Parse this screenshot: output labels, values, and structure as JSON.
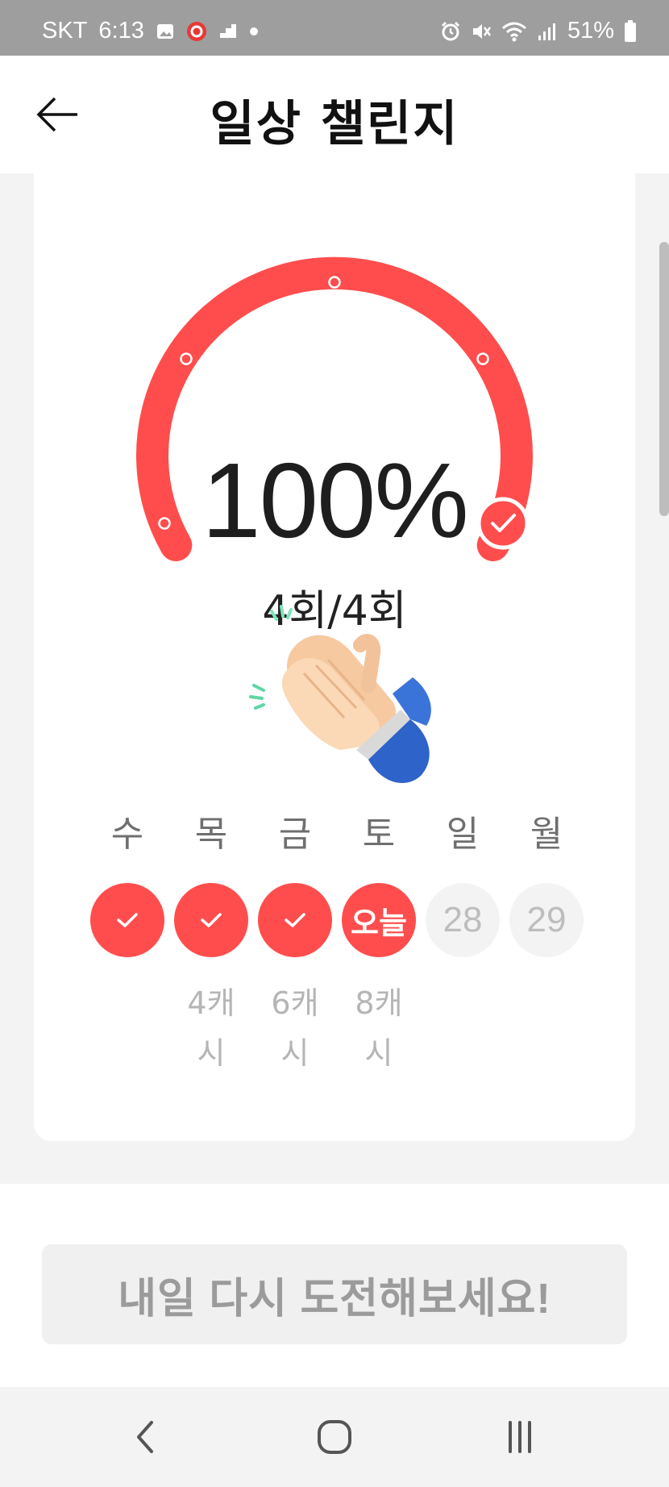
{
  "status_bar": {
    "carrier": "SKT",
    "time": "6:13",
    "battery": "51%"
  },
  "header": {
    "title": "일상 챌린지"
  },
  "challenge": {
    "progress_percent": 100,
    "percent_text": "100%",
    "count_text": "4회/4회",
    "accent_color": "#ff4d4d"
  },
  "days": [
    {
      "label": "수",
      "state": "done",
      "note": "",
      "circle_text": ""
    },
    {
      "label": "목",
      "state": "done",
      "note": "4캐시",
      "circle_text": ""
    },
    {
      "label": "금",
      "state": "done",
      "note": "6캐시",
      "circle_text": ""
    },
    {
      "label": "토",
      "state": "today",
      "note": "8캐시",
      "circle_text": "오늘"
    },
    {
      "label": "일",
      "state": "future",
      "note": "",
      "circle_text": "28"
    },
    {
      "label": "월",
      "state": "future",
      "note": "",
      "circle_text": "29"
    }
  ],
  "cta": {
    "label": "내일 다시 도전해보세요!"
  },
  "icons": {
    "back": "arrow-left-icon",
    "check": "check-icon",
    "clap": "clapping-hands-icon",
    "nav_back": "chevron-left-icon",
    "nav_home": "home-icon",
    "nav_recents": "recents-icon"
  }
}
